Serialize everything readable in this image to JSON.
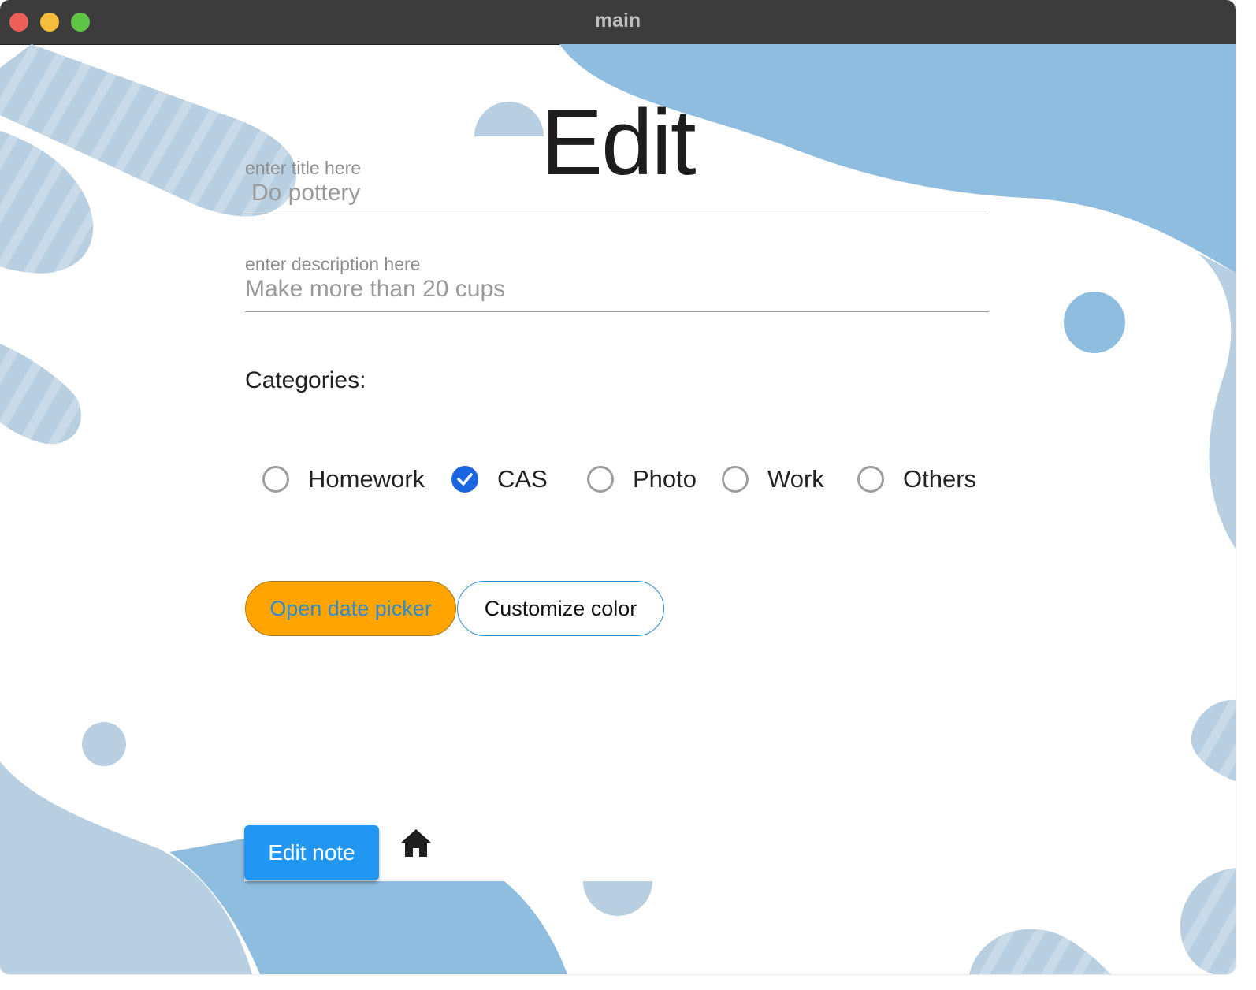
{
  "window": {
    "title": "main"
  },
  "page": {
    "heading": "Edit"
  },
  "form": {
    "title": {
      "label": "enter title here",
      "value": "Do pottery"
    },
    "description": {
      "label": "enter description here",
      "value": "Make more than 20 cups"
    },
    "categories_label": "Categories:",
    "categories": [
      {
        "label": "Homework",
        "checked": false
      },
      {
        "label": "CAS",
        "checked": true
      },
      {
        "label": "Photo",
        "checked": false
      },
      {
        "label": "Work",
        "checked": false
      },
      {
        "label": "Others",
        "checked": false
      }
    ]
  },
  "buttons": {
    "date_picker": "Open date picker",
    "customize_color": "Customize color",
    "edit_note": "Edit note",
    "home_icon": "home-icon"
  },
  "colors": {
    "accent_blue": "#2196f3",
    "checked_radio": "#1a66e0",
    "date_button": "#ffa400",
    "background_shapes": "#8fbde0"
  }
}
